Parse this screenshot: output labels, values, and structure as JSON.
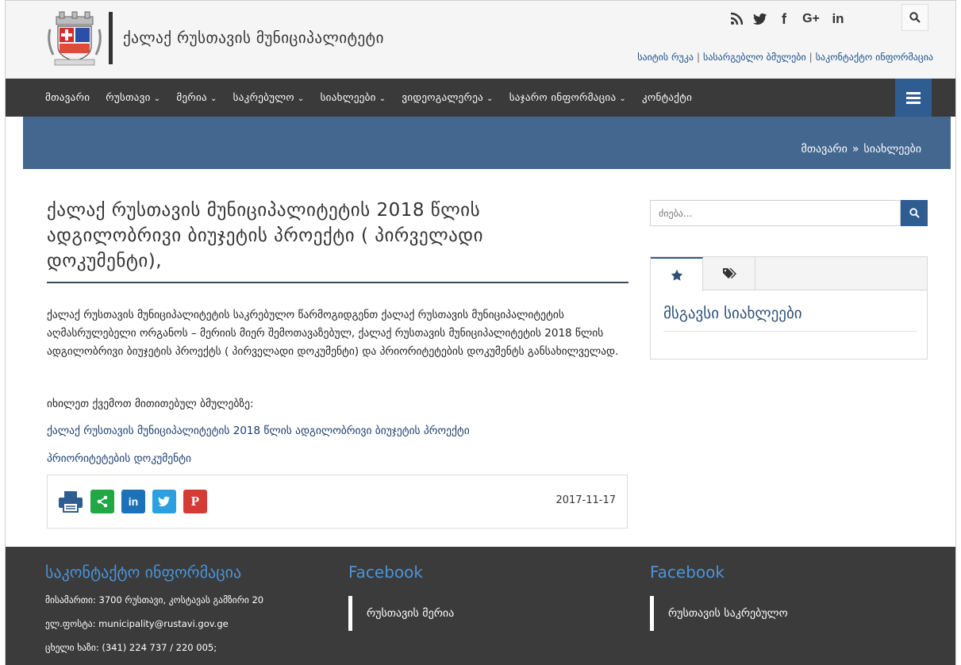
{
  "header": {
    "site_title": "ქალაქ რუსთავის მუნიციპალიტეტი",
    "social_icons": [
      "rss-icon",
      "twitter-icon",
      "facebook-icon",
      "google-plus-icon",
      "linkedin-icon"
    ],
    "social_glyphs": [
      "ᵊ",
      "🐦",
      "f",
      "G+",
      "in"
    ],
    "top_links": [
      "საიტის რუკა",
      "სასარგებლო ბმულები",
      "საკონტაქტო ინფორმაცია"
    ]
  },
  "nav": {
    "items": [
      {
        "label": "მთავარი",
        "caret": false
      },
      {
        "label": "რუსთავი",
        "caret": true
      },
      {
        "label": "მერია",
        "caret": true
      },
      {
        "label": "საკრებულო",
        "caret": true
      },
      {
        "label": "სიახლეები",
        "caret": true
      },
      {
        "label": "ვიდეოგალერეა",
        "caret": true
      },
      {
        "label": "საჯარო ინფორმაცია",
        "caret": true
      },
      {
        "label": "კონტაქტი",
        "caret": false
      }
    ]
  },
  "breadcrumb": {
    "home": "მთავარი",
    "separator": "»",
    "current": "სიახლეები"
  },
  "article": {
    "title": "ქალაქ რუსთავის მუნიციპალიტეტის 2018 წლის ადგილობრივი ბიუჯეტის პროექტი ( პირველადი დოკუმენტი),",
    "body": "ქალაქ რუსთავის მუნიციპალიტეტის საკრებულო წარმოგიდგენთ ქალაქ რუსთავის მუნიციპალიტეტის აღმასრულებელი ორგანოს – მერიის მიერ შემოთავაზებულ, ქალაქ რუსთავის მუნიციპალიტეტის 2018 წლის ადგილობრივი ბიუჯეტის პროექტს ( პირველადი დოკუმენტი) და პრიორიტეტების დოკუმენტს განსახილველად.",
    "note": "იხილეთ ქვემოთ მითითებულ ბმულებზე:",
    "link1": "ქალაქ რუსთავის მუნიციპალიტეტის 2018 წლის ადგილობრივი ბიუჯეტის პროექტი",
    "link2": "პრიორიტეტების დოკუმენტი",
    "date": "2017-11-17"
  },
  "sidebar": {
    "search_placeholder": "ძიება...",
    "tab_heading": "მსგავსი სიახლეები"
  },
  "footer": {
    "contact_title": "საკონტაქტო ინფორმაცია",
    "address": "მისამართი: 3700 რუსთავი, კოსტავას გამზირი 20",
    "email": "ელ.ფოსტა: municipality@rustavi.gov.ge",
    "phone": "ცხელი ხაზი: (341) 224 737 / 220 005;",
    "fb_title_1": "Facebook",
    "fb_link_1": "რუსთავის მერია",
    "fb_title_2": "Facebook",
    "fb_link_2": "რუსთავის საკრებულო"
  },
  "colors": {
    "nav_bg": "#3a3a3a",
    "accent_blue": "#2f5d92",
    "band_blue": "#43678f",
    "footer_bg": "#3b3b3b",
    "footer_title": "#4b94d8"
  }
}
